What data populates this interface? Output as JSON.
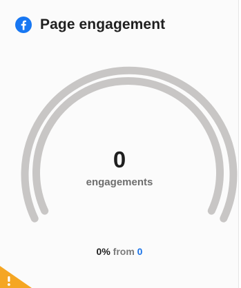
{
  "card": {
    "title": "Page engagement",
    "icon": "facebook-icon",
    "brand_color": "#1877f2"
  },
  "metric": {
    "value": "0",
    "unit": "engagements",
    "gauge_fraction": 0
  },
  "comparison": {
    "percent": "0%",
    "from_label": "from",
    "previous_value": "0"
  },
  "warning": {
    "icon": "warning-icon",
    "color": "#f5a623"
  }
}
